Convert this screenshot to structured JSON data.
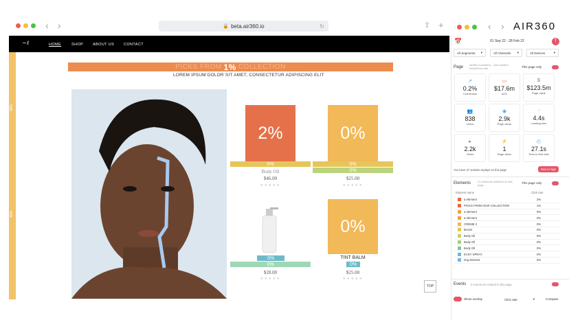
{
  "browser": {
    "url": "beta.air360.io"
  },
  "brand": {
    "logo": "AIR360"
  },
  "site": {
    "nav": [
      "HOME",
      "SHOP",
      "ABOUT US",
      "CONTACT"
    ],
    "banner_prefix": "PICKS FROM",
    "banner_pct": "1%",
    "banner_suffix": "COLLECTION",
    "subtitle": "LOREM IPSUM DOLOR SIT AMET, CONSECTETUR ADIPISCING ELIT",
    "strip_top": "38%",
    "strip_bottom": "40%",
    "products": [
      {
        "pct": "2%",
        "bar1": "0%",
        "bar2": "",
        "name": "Body Oil",
        "price": "$46.00",
        "color": "#e5714b"
      },
      {
        "pct": "0%",
        "bar1": "0%",
        "bar2": "0%",
        "name": "",
        "price": "$25.00",
        "color": "#f1b957"
      },
      {
        "pct": "",
        "bar1": "0%",
        "bar2": "0%",
        "name": "",
        "price": "$28.00",
        "color": "#ffffff"
      },
      {
        "pct": "0%",
        "bar1": "0%",
        "bar2": "",
        "name": "TINT BALM",
        "price": "$25.00",
        "color": "#f1b957"
      }
    ],
    "top": "TOP"
  },
  "panel": {
    "date": "01 Sep 22 - 28 Feb 22",
    "filters": [
      "All Segments",
      "All Channels",
      "All Devices"
    ],
    "page_label": "Page",
    "page_name": "Air360 Cosmetics - Just another WordPress site",
    "page_scope": "This page only",
    "metrics": [
      {
        "value": "0.2%",
        "label": "Conversion",
        "icon": "↗",
        "color": "#4aa3df"
      },
      {
        "value": "$17.6m",
        "label": "AOV",
        "icon": "▭",
        "color": "#e8683b"
      },
      {
        "value": "$123.5m",
        "label": "Page value",
        "icon": "$",
        "color": "#35a853"
      },
      {
        "value": "838",
        "label": "Users",
        "icon": "👥",
        "color": "#e4576b"
      },
      {
        "value": "2.9k",
        "label": "Page views",
        "icon": "◉",
        "color": "#4aa3df"
      },
      {
        "value": "4.4s",
        "label": "Loading time",
        "icon": "◔",
        "color": "#f2b33d"
      },
      {
        "value": "2.2k",
        "label": "Clicks",
        "icon": "▸",
        "color": "#35a853"
      },
      {
        "value": "1",
        "label": "Rage clicks",
        "icon": "⚡",
        "color": "#f2b33d"
      },
      {
        "value": "27.1s",
        "label": "Time to first click",
        "icon": "◴",
        "color": "#4aa3df"
      }
    ],
    "replay_text": "You have 27 session replays on this page",
    "replay_btn": "See in App",
    "elements_label": "Elements",
    "elements_count": "21 elements selected on this page",
    "elements_scope": "This page only",
    "col_name": "Element name",
    "col_rate": "Click rate",
    "rows": [
      {
        "name": "a element",
        "rate": "2%",
        "color": "#e6683b"
      },
      {
        "name": "PICKS FROM OUR COLLECTION",
        "rate": "1%",
        "color": "#e6683b"
      },
      {
        "name": "a element",
        "rate": "0%",
        "color": "#f0a13b"
      },
      {
        "name": "a element",
        "rate": "0%",
        "color": "#f0a13b"
      },
      {
        "name": "CREME 2",
        "rate": "0%",
        "color": "#f0b94a"
      },
      {
        "name": "BALM",
        "rate": "0%",
        "color": "#e9c44f"
      },
      {
        "name": "Body Oil",
        "rate": "0%",
        "color": "#c8cf6a"
      },
      {
        "name": "Body Oil",
        "rate": "0%",
        "color": "#a7cc7b"
      },
      {
        "name": "Body Oil",
        "rate": "0%",
        "color": "#86c49a"
      },
      {
        "name": "EASY SPRAY",
        "rate": "0%",
        "color": "#6fbac8"
      },
      {
        "name": "img element",
        "rate": "0%",
        "color": "#77b6de"
      }
    ],
    "events_label": "Events",
    "events_text": "0 events are related to this page",
    "overlay_label": "Show overlay",
    "overlay_metric": "Click rate",
    "compare": "Compare"
  }
}
